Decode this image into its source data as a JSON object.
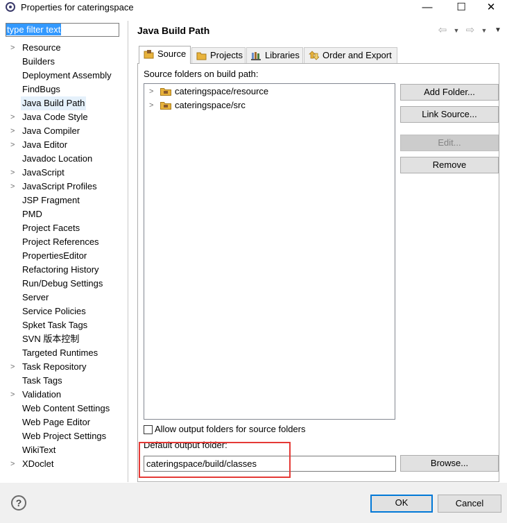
{
  "window": {
    "title": "Properties for cateringspace",
    "minimize_glyph": "—",
    "maximize_glyph": "☐",
    "close_glyph": "✕"
  },
  "sidebar": {
    "filter_value": "type filter text",
    "items": [
      {
        "label": "Resource",
        "expandable": true
      },
      {
        "label": "Builders",
        "expandable": false
      },
      {
        "label": "Deployment Assembly",
        "expandable": false
      },
      {
        "label": "FindBugs",
        "expandable": false
      },
      {
        "label": "Java Build Path",
        "expandable": false,
        "selected": true
      },
      {
        "label": "Java Code Style",
        "expandable": true
      },
      {
        "label": "Java Compiler",
        "expandable": true
      },
      {
        "label": "Java Editor",
        "expandable": true
      },
      {
        "label": "Javadoc Location",
        "expandable": false
      },
      {
        "label": "JavaScript",
        "expandable": true
      },
      {
        "label": "JavaScript Profiles",
        "expandable": true
      },
      {
        "label": "JSP Fragment",
        "expandable": false
      },
      {
        "label": "PMD",
        "expandable": false
      },
      {
        "label": "Project Facets",
        "expandable": false
      },
      {
        "label": "Project References",
        "expandable": false
      },
      {
        "label": "PropertiesEditor",
        "expandable": false
      },
      {
        "label": "Refactoring History",
        "expandable": false
      },
      {
        "label": "Run/Debug Settings",
        "expandable": false
      },
      {
        "label": "Server",
        "expandable": false
      },
      {
        "label": "Service Policies",
        "expandable": false
      },
      {
        "label": "Spket Task Tags",
        "expandable": false
      },
      {
        "label": "SVN 版本控制",
        "expandable": false
      },
      {
        "label": "Targeted Runtimes",
        "expandable": false
      },
      {
        "label": "Task Repository",
        "expandable": true
      },
      {
        "label": "Task Tags",
        "expandable": false
      },
      {
        "label": "Validation",
        "expandable": true
      },
      {
        "label": "Web Content Settings",
        "expandable": false
      },
      {
        "label": "Web Page Editor",
        "expandable": false
      },
      {
        "label": "Web Project Settings",
        "expandable": false
      },
      {
        "label": "WikiText",
        "expandable": false
      },
      {
        "label": "XDoclet",
        "expandable": true
      }
    ]
  },
  "main": {
    "title": "Java Build Path",
    "tabs": [
      {
        "label": "Source",
        "icon": "source-folder-icon",
        "active": true
      },
      {
        "label": "Projects",
        "icon": "projects-icon",
        "active": false
      },
      {
        "label": "Libraries",
        "icon": "libraries-icon",
        "active": false
      },
      {
        "label": "Order and Export",
        "icon": "order-export-icon",
        "active": false
      }
    ],
    "source_label": "Source folders on build path:",
    "source_folders": [
      {
        "label": "cateringspace/resource"
      },
      {
        "label": "cateringspace/src"
      }
    ],
    "buttons": {
      "add_folder": "Add Folder...",
      "link_source": "Link Source...",
      "edit": "Edit...",
      "remove": "Remove",
      "browse": "Browse..."
    },
    "allow_output_label": "Allow output folders for source folders",
    "allow_output_checked": false,
    "default_output_label": "Default output folder:",
    "default_output_value": "cateringspace/build/classes"
  },
  "footer": {
    "help_glyph": "?",
    "ok_label": "OK",
    "cancel_label": "Cancel"
  },
  "colors": {
    "highlight_box": "#e53935",
    "selection_blue": "#3399ff",
    "default_button_border": "#0078d7"
  }
}
